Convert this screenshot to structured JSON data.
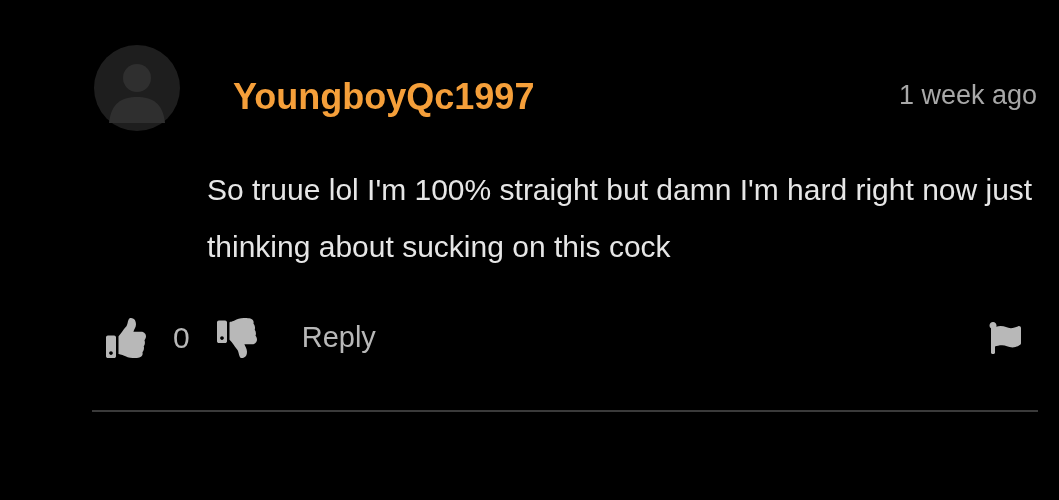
{
  "comment": {
    "username": "YoungboyQc1997",
    "time": "1 week ago",
    "text": "So truue lol I'm 100% straight but damn I'm hard right now just thinking about sucking on this cock",
    "likes": "0",
    "reply_label": "Reply"
  }
}
